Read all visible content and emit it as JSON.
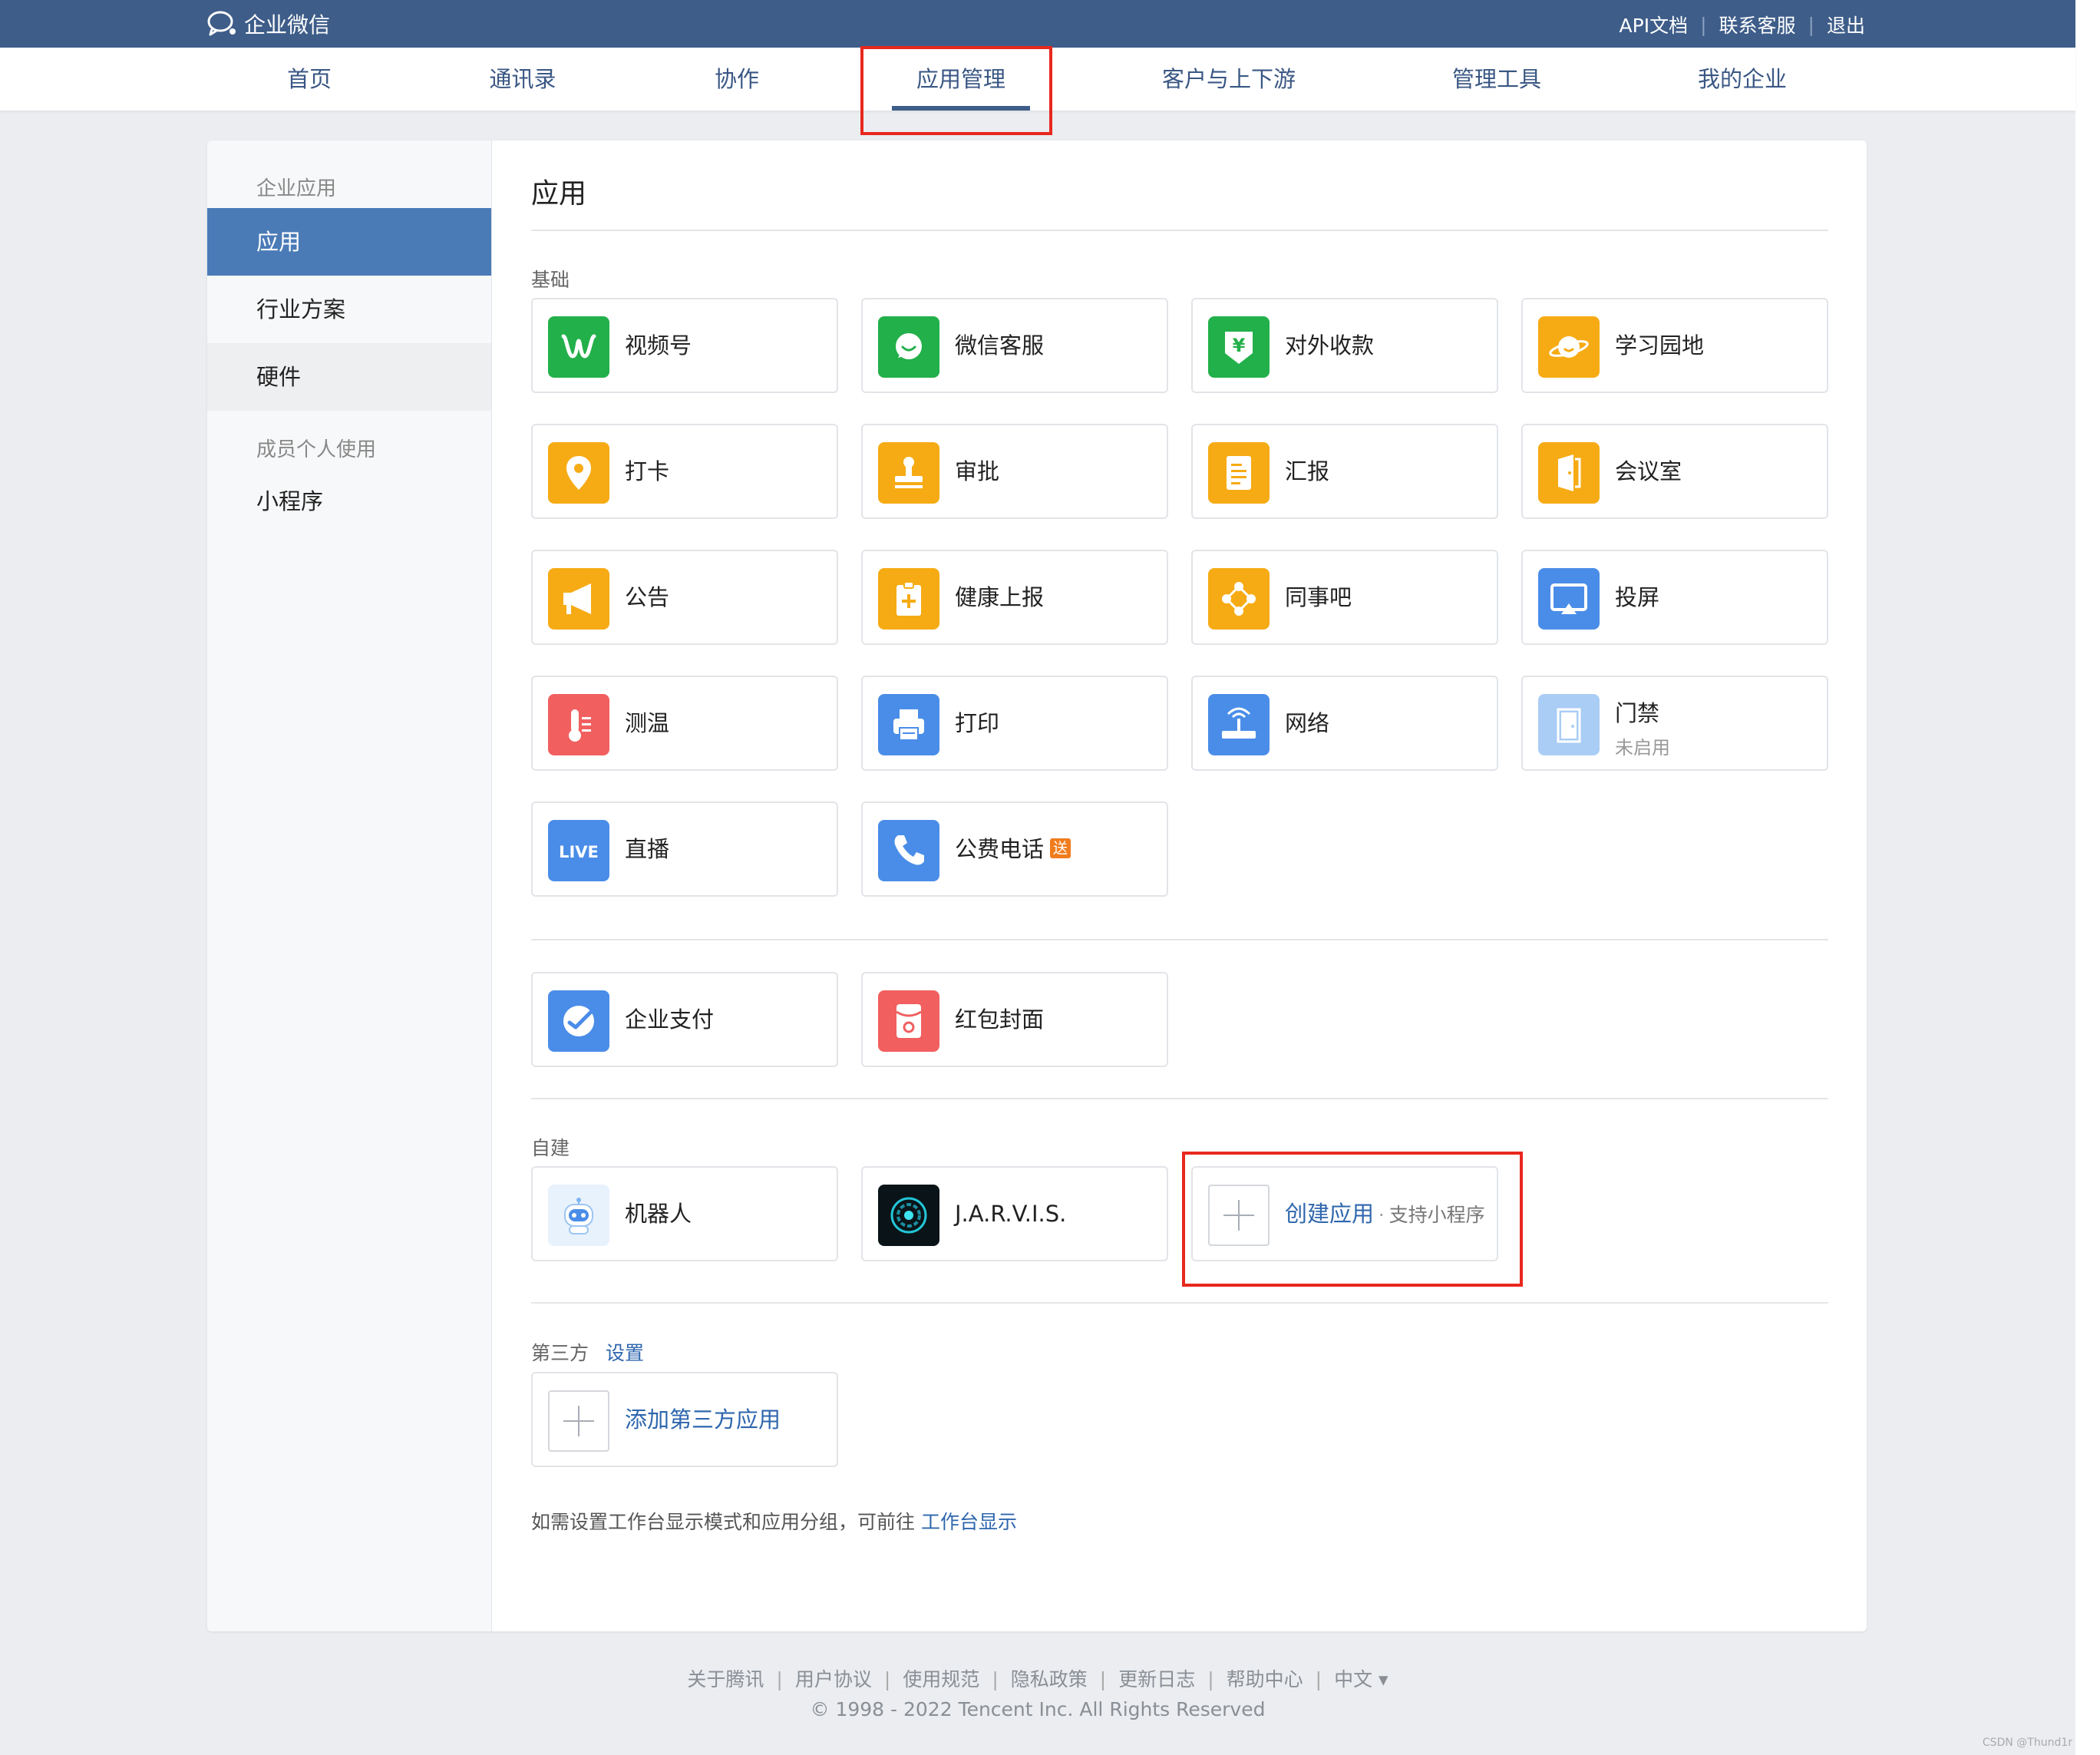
{
  "brand": {
    "name": "企业微信"
  },
  "top_links": [
    "API文档",
    "联系客服",
    "退出"
  ],
  "nav": [
    "首页",
    "通讯录",
    "协作",
    "应用管理",
    "客户与上下游",
    "管理工具",
    "我的企业"
  ],
  "sidebar": {
    "group1": "企业应用",
    "items1": [
      "应用",
      "行业方案",
      "硬件"
    ],
    "group2": "成员个人使用",
    "items2": [
      "小程序"
    ]
  },
  "content": {
    "title": "应用",
    "basic_label": "基础",
    "basic_apps": [
      {
        "name": "视频号",
        "icon": "channels-icon",
        "color": "#22b04a"
      },
      {
        "name": "微信客服",
        "icon": "wechat-service-icon",
        "color": "#22b04a"
      },
      {
        "name": "对外收款",
        "icon": "payment-icon",
        "color": "#22b04a"
      },
      {
        "name": "学习园地",
        "icon": "planet-icon",
        "color": "#f6ab14"
      },
      {
        "name": "打卡",
        "icon": "location-pin-icon",
        "color": "#f6ab14"
      },
      {
        "name": "审批",
        "icon": "stamp-icon",
        "color": "#f6ab14"
      },
      {
        "name": "汇报",
        "icon": "report-icon",
        "color": "#f6ab14"
      },
      {
        "name": "会议室",
        "icon": "door-icon",
        "color": "#f6ab14"
      },
      {
        "name": "公告",
        "icon": "megaphone-icon",
        "color": "#f6ab14"
      },
      {
        "name": "健康上报",
        "icon": "health-report-icon",
        "color": "#f6ab14"
      },
      {
        "name": "同事吧",
        "icon": "colleague-circle-icon",
        "color": "#f6ab14"
      },
      {
        "name": "投屏",
        "icon": "screencast-icon",
        "color": "#4a8de8"
      },
      {
        "name": "测温",
        "icon": "thermometer-icon",
        "color": "#f15f5f"
      },
      {
        "name": "打印",
        "icon": "printer-icon",
        "color": "#4a8de8"
      },
      {
        "name": "网络",
        "icon": "router-icon",
        "color": "#4a8de8"
      },
      {
        "name": "门禁",
        "sub": "未启用",
        "icon": "door-access-icon",
        "color": "#aacdf5"
      },
      {
        "name": "直播",
        "icon": "live-icon",
        "color": "#4a8de8"
      },
      {
        "name": "公费电话",
        "badge": "送",
        "icon": "phone-icon",
        "color": "#4a8de8"
      }
    ],
    "pay_apps": [
      {
        "name": "企业支付",
        "icon": "enterprise-pay-icon",
        "color": "#4a8de8"
      },
      {
        "name": "红包封面",
        "icon": "red-envelope-icon",
        "color": "#f15f5f"
      }
    ],
    "custom_label": "自建",
    "custom_apps": [
      {
        "name": "机器人",
        "icon": "robot-icon"
      },
      {
        "name": "J.A.R.V.I.S.",
        "icon": "jarvis-icon"
      }
    ],
    "create_app": {
      "label": "创建应用",
      "dot": "·",
      "hint": "支持小程序"
    },
    "third_party_label": "第三方",
    "third_party_settings": "设置",
    "add_third_party": "添加第三方应用",
    "note_text": "如需设置工作台显示模式和应用分组，可前往",
    "note_link": "工作台显示"
  },
  "footer": {
    "links": [
      "关于腾讯",
      "用户协议",
      "使用规范",
      "隐私政策",
      "更新日志",
      "帮助中心",
      "中文 ▾"
    ],
    "copyright": "© 1998 - 2022 Tencent Inc. All Rights Reserved"
  },
  "watermark": "CSDN @Thund1r"
}
